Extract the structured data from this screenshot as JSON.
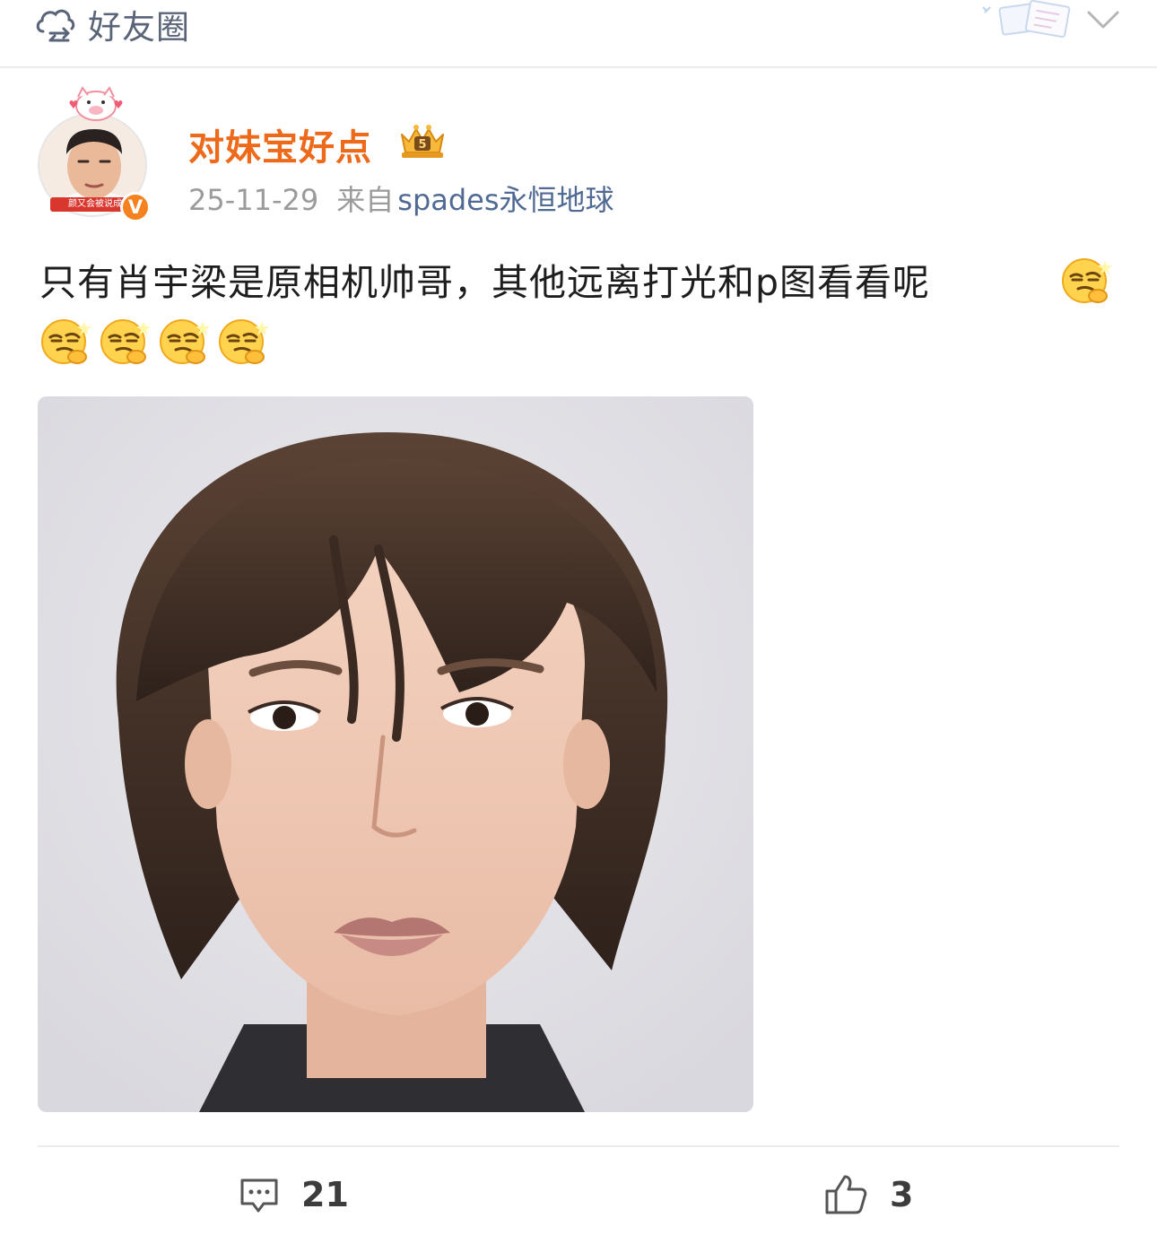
{
  "topbar": {
    "visibility_label": "好友圈",
    "visibility_icon": "cloud-share-icon",
    "decoration_icon": "notebook-sticker-icon",
    "menu_icon": "chevron-down-icon"
  },
  "post": {
    "author": {
      "name": "对妹宝好点",
      "avatar_caption": "颜又会被说成",
      "verified_mark": "V",
      "verified_color": "#f5821f",
      "name_color": "#ec6a19",
      "level_badge_icon": "crown-level-badge-icon"
    },
    "time": "25-11-29",
    "from_label": "来自",
    "source": "spades永恒地球",
    "text": "只有肖宇梁是原相机帅哥，其他远离打光和p图看看呢",
    "emoji_icon": "thinking-smirk-emoji-icon",
    "emoji_count": 5,
    "image_alt_icon": "portrait-photo"
  },
  "actions": {
    "comment_icon": "comment-icon",
    "comment_count": "21",
    "like_icon": "thumbs-up-icon",
    "like_count": "3"
  },
  "colors": {
    "source_link": "#516a94",
    "meta_grey": "#9b9b9b",
    "topbar_label": "#5a6478"
  }
}
